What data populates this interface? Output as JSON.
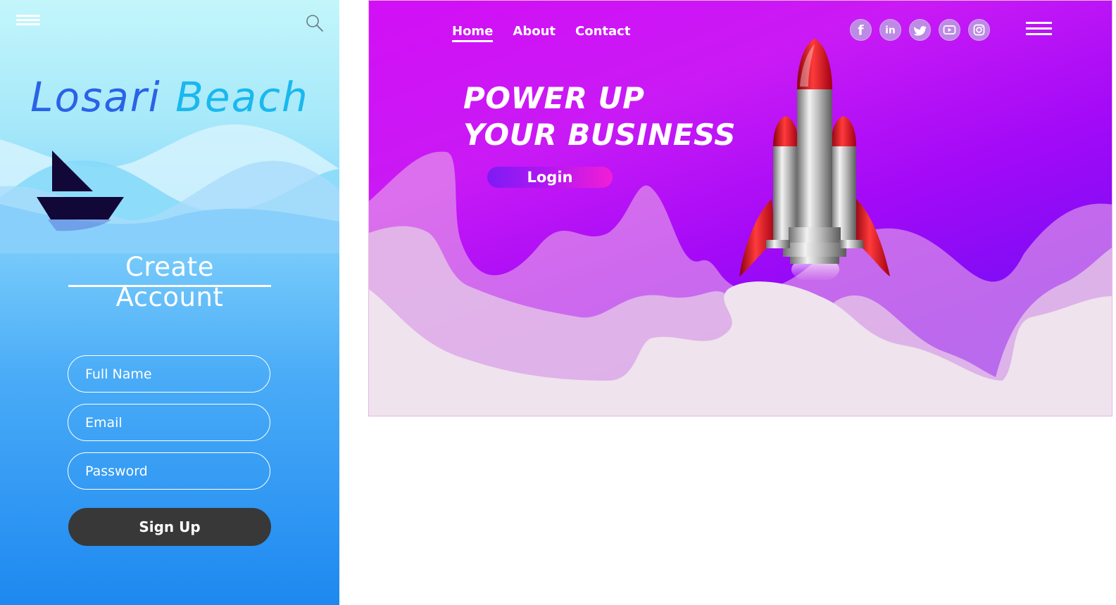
{
  "mobile": {
    "brand": {
      "part1": "Losari",
      "part2": "Beach"
    },
    "title": "Create Account",
    "fields": {
      "full_name_placeholder": "Full Name",
      "email_placeholder": "Email",
      "password_placeholder": "Password"
    },
    "signup_label": "Sign Up",
    "icons": {
      "menu": "hamburger-icon",
      "search": "search-icon",
      "boat": "sailboat-icon"
    }
  },
  "hero": {
    "nav": {
      "home": "Home",
      "about": "About",
      "contact": "Contact"
    },
    "socials": [
      "facebook-icon",
      "linkedin-icon",
      "twitter-icon",
      "youtube-icon",
      "instagram-icon"
    ],
    "headline": {
      "line1": "POWER UP",
      "line2": "YOUR BUSINESS"
    },
    "login_label": "Login"
  },
  "colors": {
    "mobile_top": "#c3f6fb",
    "mobile_bottom": "#1d88f0",
    "brand_dark": "#2a63e6",
    "brand_light": "#1ab8ee",
    "hero_purple": "#a40af7",
    "hero_magenta": "#d20ff5",
    "signup_button": "#383838",
    "rocket_red": "#e0001b"
  }
}
